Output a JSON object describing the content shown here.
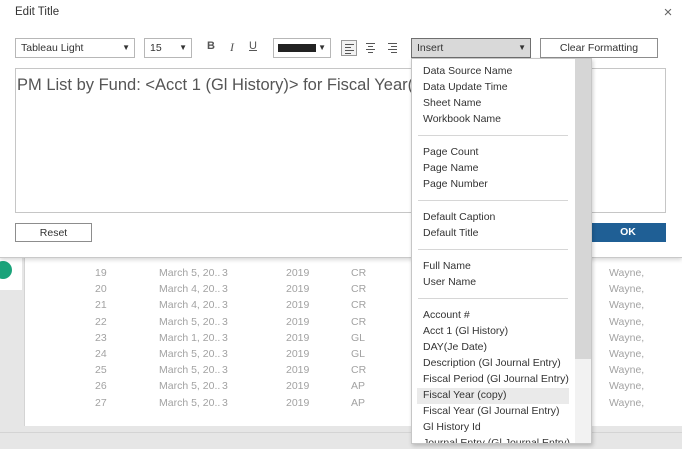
{
  "dialog": {
    "title": "Edit Title",
    "close_glyph": "×",
    "font": "Tableau Light",
    "size": "15",
    "bold": "B",
    "italic": "I",
    "underline": "U",
    "insert_label": "Insert",
    "clear_label": "Clear Formatting",
    "text": "PM List by Fund: <Acct 1 (Gl History)> for Fiscal Year(",
    "reset_label": "Reset",
    "ok_label": "OK",
    "text_color": "#222222",
    "accent": "#1f5f95"
  },
  "insert_menu": {
    "groups": [
      [
        "Data Source Name",
        "Data Update Time",
        "Sheet Name",
        "Workbook Name"
      ],
      [
        "Page Count",
        "Page Name",
        "Page Number"
      ],
      [
        "Default Caption",
        "Default Title"
      ],
      [
        "Full Name",
        "User Name"
      ],
      [
        "Account #",
        "Acct 1 (Gl History)",
        "DAY(Je Date)",
        "Description (Gl Journal Entry)",
        "Fiscal Period (Gl Journal Entry)",
        "Fiscal Year (copy)",
        "Fiscal Year (Gl Journal Entry)",
        "Gl History Id",
        "Journal Entry (Gl Journal Entry)"
      ]
    ],
    "highlighted": "Fiscal Year (copy)"
  },
  "background_rows": [
    {
      "num": "19",
      "date": "March 5, 20..",
      "period": "3",
      "year": "2019",
      "type": "CR",
      "name": "Wayne,"
    },
    {
      "num": "20",
      "date": "March 4, 20..",
      "period": "3",
      "year": "2019",
      "type": "CR",
      "name": "Wayne,"
    },
    {
      "num": "21",
      "date": "March 4, 20..",
      "period": "3",
      "year": "2019",
      "type": "CR",
      "name": "Wayne,"
    },
    {
      "num": "22",
      "date": "March 5, 20..",
      "period": "3",
      "year": "2019",
      "type": "CR",
      "name": "Wayne,"
    },
    {
      "num": "23",
      "date": "March 1, 20..",
      "period": "3",
      "year": "2019",
      "type": "GL",
      "name": "Wayne,"
    },
    {
      "num": "24",
      "date": "March 5, 20..",
      "period": "3",
      "year": "2019",
      "type": "GL",
      "name": "Wayne,"
    },
    {
      "num": "25",
      "date": "March 5, 20..",
      "period": "3",
      "year": "2019",
      "type": "CR",
      "name": "Wayne,"
    },
    {
      "num": "26",
      "date": "March 5, 20..",
      "period": "3",
      "year": "2019",
      "type": "AP",
      "name": "Wayne,"
    },
    {
      "num": "27",
      "date": "March 5, 20..",
      "period": "3",
      "year": "2019",
      "type": "AP",
      "name": "Wayne,"
    }
  ]
}
